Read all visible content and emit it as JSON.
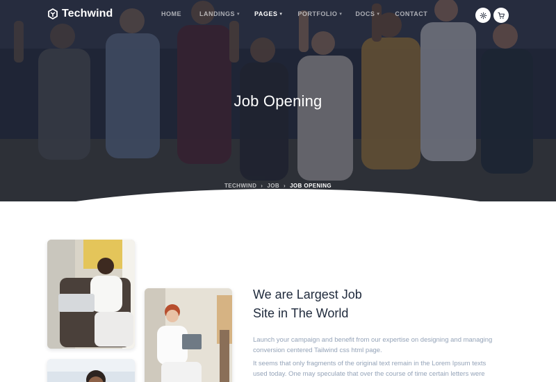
{
  "brand": {
    "name": "Techwind"
  },
  "nav": {
    "items": [
      {
        "label": "HOME",
        "has_dropdown": false,
        "active": false
      },
      {
        "label": "LANDINGS",
        "has_dropdown": true,
        "active": false
      },
      {
        "label": "PAGES",
        "has_dropdown": true,
        "active": true
      },
      {
        "label": "PORTFOLIO",
        "has_dropdown": true,
        "active": false
      },
      {
        "label": "DOCS",
        "has_dropdown": true,
        "active": false
      },
      {
        "label": "CONTACT",
        "has_dropdown": false,
        "active": false
      }
    ],
    "chevron": "›",
    "icons": {
      "settings": "gear-icon",
      "cart": "shopping-cart-icon"
    }
  },
  "hero": {
    "title": "Job Opening",
    "breadcrumb": {
      "items": [
        "TECHWIND",
        "JOB"
      ],
      "current": "JOB OPENING",
      "separator": "›"
    }
  },
  "about": {
    "title_line1": "We are Largest Job",
    "title_line2": "Site in The World",
    "paragraph1": "Launch your campaign and benefit from our expertise on designing and managing conversion centered Tailwind css html page.",
    "paragraph2": "It seems that only fragments of the original text remain in the Lorem Ipsum texts used today. One may speculate that over the course of time certain letters were"
  },
  "colors": {
    "hero_overlay": "#161c2d",
    "heading": "#1e293b",
    "body_text": "#94a3b8",
    "white": "#ffffff"
  }
}
